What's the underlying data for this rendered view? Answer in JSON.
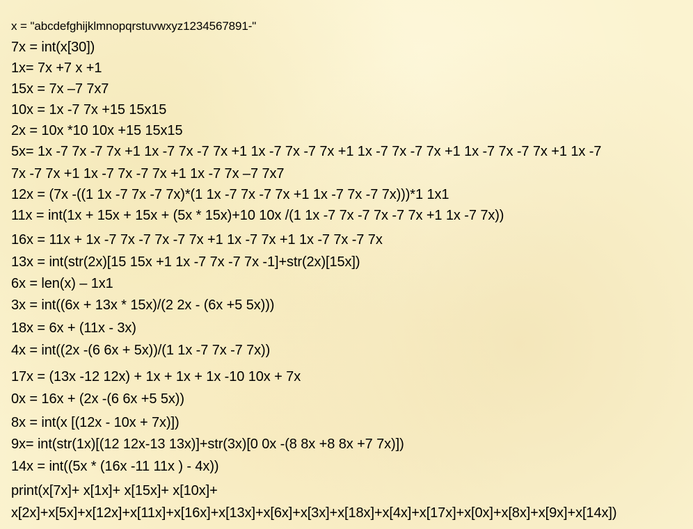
{
  "lines": [
    "x = \"abcdefghijklmnopqrstuvwxyz1234567891-\"",
    "7x = int(x[30])",
    "1x= 7x +7 x +1",
    "15x = 7x –7 7x7",
    "10x = 1x -7 7x +15 15x15",
    "2x = 10x *10 10x +15 15x15",
    "5x= 1x -7 7x -7 7x +1 1x -7 7x -7 7x +1 1x -7 7x -7 7x +1 1x -7 7x -7 7x +1 1x -7 7x -7 7x +1 1x -7",
    "7x -7 7x +1 1x -7 7x -7 7x +1 1x -7 7x –7 7x7",
    "12x = (7x -((1 1x -7 7x -7 7x)*(1 1x -7 7x -7 7x +1 1x -7 7x -7 7x)))*1 1x1",
    "11x = int(1x + 15x + 15x + (5x * 15x)+10 10x /(1 1x -7 7x -7 7x -7 7x +1 1x -7 7x))",
    "16x = 11x + 1x -7 7x -7 7x -7 7x +1 1x -7 7x +1 1x -7 7x -7 7x",
    "13x = int(str(2x)[15 15x +1 1x -7 7x -7 7x -1]+str(2x)[15x])",
    "6x = len(x) – 1x1",
    "3x = int((6x + 13x * 15x)/(2 2x - (6x +5 5x)))",
    "18x = 6x + (11x - 3x)",
    "4x = int((2x -(6 6x + 5x))/(1 1x -7 7x -7 7x))",
    "17x = (13x -12 12x) + 1x + 1x + 1x -10 10x + 7x",
    "0x = 16x + (2x -(6 6x +5 5x))",
    "8x = int(x [(12x - 10x + 7x)])",
    "9x= int(str(1x)[(12 12x-13 13x)]+str(3x)[0 0x -(8 8x +8 8x +7 7x)])",
    "14x = int((5x * (16x -11 11x ) - 4x))",
    "print(x[7x]+ x[1x]+ x[15x]+ x[10x]+",
    "x[2x]+x[5x]+x[12x]+x[11x]+x[16x]+x[13x]+x[6x]+x[3x]+x[18x]+x[4x]+x[17x]+x[0x]+x[8x]+x[9x]+x[14x])"
  ]
}
